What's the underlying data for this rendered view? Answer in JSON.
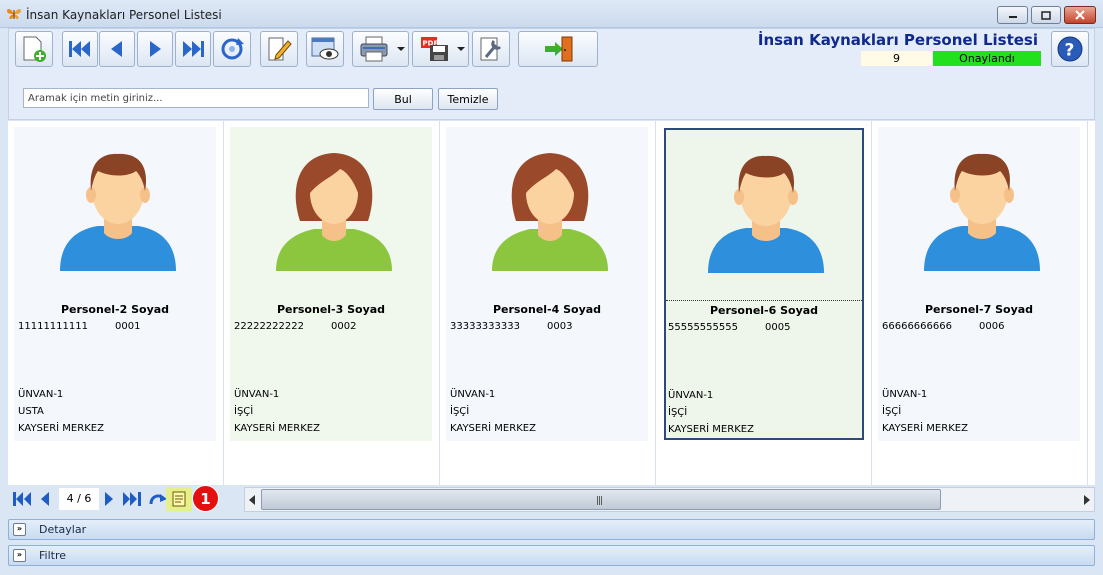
{
  "window": {
    "title": "İnsan Kaynakları Personel Listesi"
  },
  "header": {
    "title": "İnsan Kaynakları Personel Listesi",
    "record_count": "9",
    "status": "Onaylandı",
    "status_color": "#22e01e"
  },
  "search": {
    "placeholder": "Aramak için metin giriniz...",
    "value": "",
    "find_label": "Bul",
    "clear_label": "Temizle"
  },
  "toolbar": {
    "buttons": [
      "new-record-icon",
      "first-record-icon",
      "previous-record-icon",
      "next-record-icon",
      "last-record-icon",
      "refresh-icon",
      "edit-icon",
      "preview-icon",
      "print-icon",
      "pdf-export-icon",
      "tools-icon",
      "exit-icon",
      "help-icon"
    ]
  },
  "cards": [
    {
      "name": "Personel-2 Soyad",
      "tc": "11111111111",
      "no": "0001",
      "title": "ÜNVAN-1",
      "role": "USTA",
      "location": "KAYSERİ MERKEZ",
      "gender": "male"
    },
    {
      "name": "Personel-3 Soyad",
      "tc": "22222222222",
      "no": "0002",
      "title": "ÜNVAN-1",
      "role": "İŞÇİ",
      "location": "KAYSERİ MERKEZ",
      "gender": "female"
    },
    {
      "name": "Personel-4 Soyad",
      "tc": "33333333333",
      "no": "0003",
      "title": "ÜNVAN-1",
      "role": "İŞÇİ",
      "location": "KAYSERİ MERKEZ",
      "gender": "female"
    },
    {
      "name": "Personel-6 Soyad",
      "tc": "55555555555",
      "no": "0005",
      "title": "ÜNVAN-1",
      "role": "İŞÇİ",
      "location": "KAYSERİ MERKEZ",
      "gender": "male"
    },
    {
      "name": "Personel-7 Soyad",
      "tc": "66666666666",
      "no": "0006",
      "title": "ÜNVAN-1",
      "role": "İŞÇİ",
      "location": "KAYSERİ MERKEZ",
      "gender": "male"
    }
  ],
  "navigator": {
    "position": "4 / 6",
    "badge": "1"
  },
  "panels": {
    "details": "Detaylar",
    "filter": "Filtre"
  }
}
